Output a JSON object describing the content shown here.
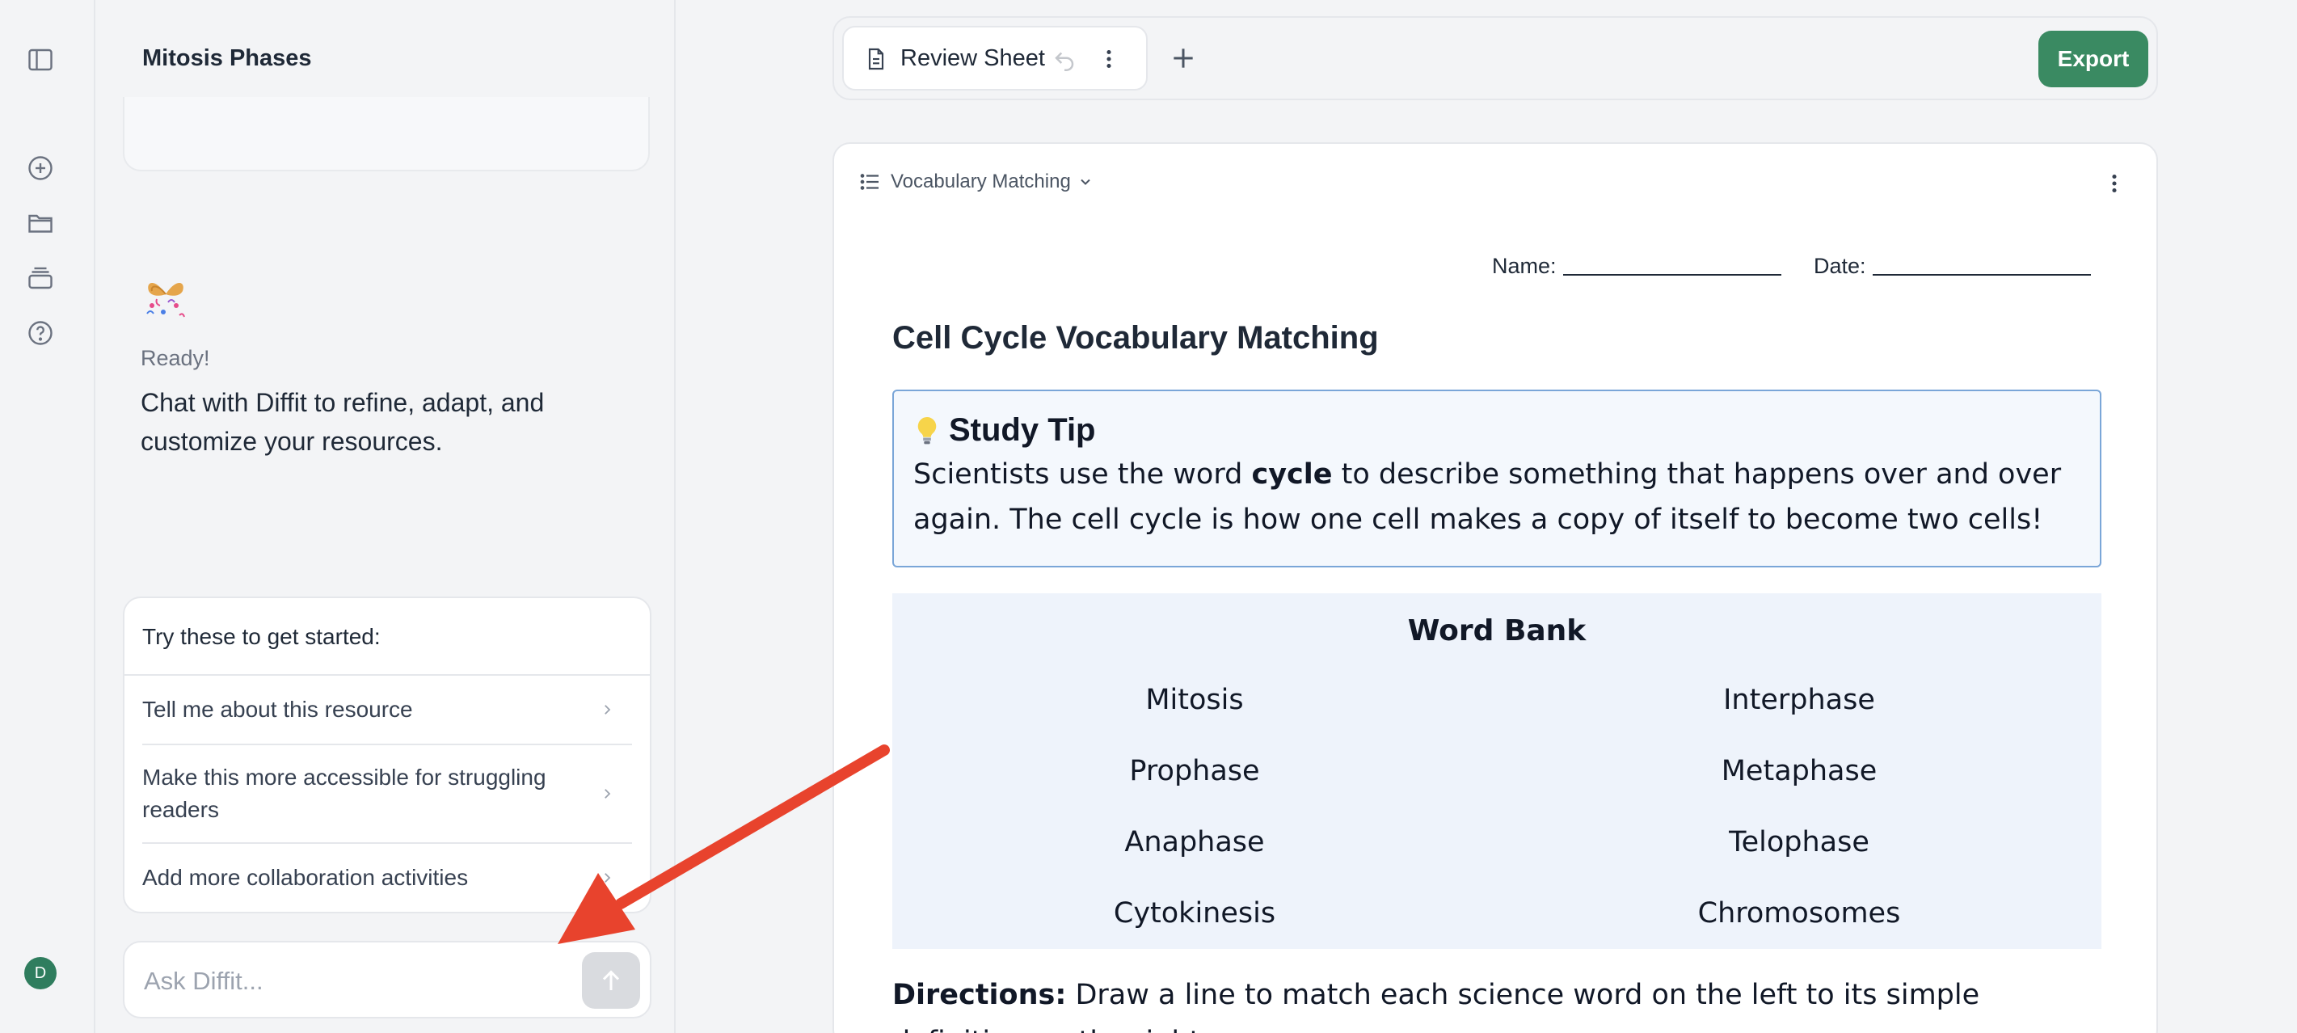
{
  "chat": {
    "title": "Mitosis Phases",
    "ready": "Ready!",
    "intro": "Chat with Diffit to refine, adapt, and customize your resources.",
    "suggestions_heading": "Try these to get started:",
    "suggestions": [
      "Tell me about this resource",
      "Make this more accessible for struggling readers",
      "Add more collaboration activities"
    ],
    "input_placeholder": "Ask Diffit..."
  },
  "user": {
    "avatar_initial": "D"
  },
  "rail_icons": [
    "sidebar-toggle-icon",
    "new-chat-icon",
    "folder-icon",
    "library-icon",
    "help-icon"
  ],
  "tabs": {
    "active_label": "Review Sheet",
    "export_label": "Export"
  },
  "doc": {
    "section_label": "Vocabulary Matching",
    "name_label": "Name:",
    "date_label": "Date:",
    "title": "Cell Cycle Vocabulary Matching",
    "tip_title": "Study Tip",
    "tip_before": "Scientists use the word ",
    "tip_bold": "cycle",
    "tip_after": " to describe something that happens over and over again. The cell cycle is how one cell makes a copy of itself to become two cells!",
    "word_bank_title": "Word Bank",
    "words": [
      "Mitosis",
      "Interphase",
      "Prophase",
      "Metaphase",
      "Anaphase",
      "Telophase",
      "Cytokinesis",
      "Chromosomes"
    ],
    "directions_label": "Directions:",
    "directions_text": " Draw a line to match each science word on the left to its simple definition on the right."
  },
  "colors": {
    "accent": "#3a8a62",
    "tip_border": "#7aa6d8",
    "word_bank_bg": "#eef3fb",
    "annotation_arrow": "#e8432d"
  }
}
